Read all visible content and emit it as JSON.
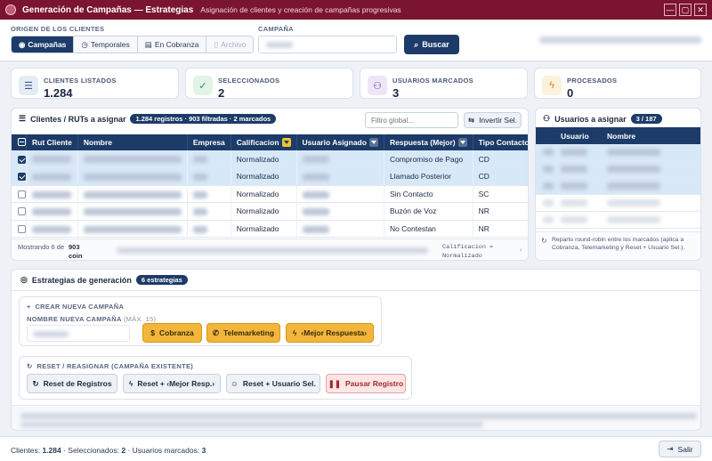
{
  "window": {
    "title": "Generación de Campañas — Estrategias",
    "subtitle": "Asignación de clientes y creación de campañas progresivas",
    "controls": [
      "—",
      "▢",
      "✕"
    ]
  },
  "origin": {
    "label": "ORIGEN DE LOS CLIENTES",
    "tabs": [
      {
        "label": "Campañas"
      },
      {
        "label": "Temporales"
      },
      {
        "label": "En Cobranza"
      },
      {
        "label": "Archivo"
      }
    ]
  },
  "campaign": {
    "label": "CAMPAÑA",
    "search_label": "Buscar"
  },
  "stats": [
    {
      "label": "CLIENTES LISTADOS",
      "value": "1.284",
      "icon": "list-icon",
      "color": "#3b5b8c",
      "bg": "#e6ecf5"
    },
    {
      "label": "SELECCIONADOS",
      "value": "2",
      "icon": "check-icon",
      "color": "#2a8a52",
      "bg": "#e2f3e8"
    },
    {
      "label": "USUARIOS MARCADOS",
      "value": "3",
      "icon": "users-icon",
      "color": "#6a4a9a",
      "bg": "#ece6f6"
    },
    {
      "label": "PROCESADOS",
      "value": "0",
      "icon": "bolt-icon",
      "color": "#c98a10",
      "bg": "#fbf1dc"
    }
  ],
  "clients_panel": {
    "title": "Clientes / RUTs a asignar",
    "badge": "1.284 registros · 903 filtradas · 2 marcados",
    "filter_placeholder": "Filtro global...",
    "invert_label": "Invertir Sel.",
    "columns": [
      "Rut Cliente",
      "Nombre",
      "Empresa",
      "Calificacion",
      "Usuario Asignado",
      "Respuesta (Mejor)",
      "Tipo Contacto (Mej"
    ],
    "rows": [
      {
        "calificacion": "Normalizado",
        "respuesta": "Compromiso de Pago",
        "tipo": "CD",
        "selected": true
      },
      {
        "calificacion": "Normalizado",
        "respuesta": "Llamado Posterior",
        "tipo": "CD",
        "selected": true
      },
      {
        "calificacion": "Normalizado",
        "respuesta": "Sin Contacto",
        "tipo": "SC",
        "selected": false
      },
      {
        "calificacion": "Normalizado",
        "respuesta": "Buzón de Voz",
        "tipo": "NR",
        "selected": false
      },
      {
        "calificacion": "Normalizado",
        "respuesta": "No Contestan",
        "tipo": "NR",
        "selected": false
      }
    ],
    "status_prefix": "Mostrando 6 de",
    "status_count": "903 coin",
    "filter_summary": "Calificacion = Normalizado"
  },
  "users_panel": {
    "title": "Usuarios a asignar",
    "badge": "3 / 187",
    "columns": [
      "Usuario",
      "Nombre"
    ],
    "note": "Reparto round-robin entre los marcados (aplica a Cobranza, Telemarketing y Reset + Usuario Sel.)."
  },
  "strategies": {
    "title": "Estrategias de generación",
    "badge": "6 estrategias",
    "create": {
      "title": "CREAR NUEVA CAMPAÑA",
      "name_label": "NOMBRE NUEVA CAMPAÑA",
      "name_hint": "(MÁX. 15)",
      "buttons": [
        "Cobranza",
        "Telemarketing",
        "‹Mejor Respuesta›"
      ]
    },
    "reset": {
      "title": "RESET / REASIGNAR (CAMPAÑA EXISTENTE)",
      "buttons": [
        "Reset de Registros",
        "Reset + ‹Mejor Resp.›",
        "Reset + Usuario Sel.",
        "Pausar Registro"
      ]
    }
  },
  "footer": {
    "clients_label": "Clientes:",
    "clients": "1.284",
    "sel_label": "· Seleccionados:",
    "sel": "2",
    "users_label": "· Usuarios marcados:",
    "users": "3",
    "exit_label": "Salir"
  }
}
